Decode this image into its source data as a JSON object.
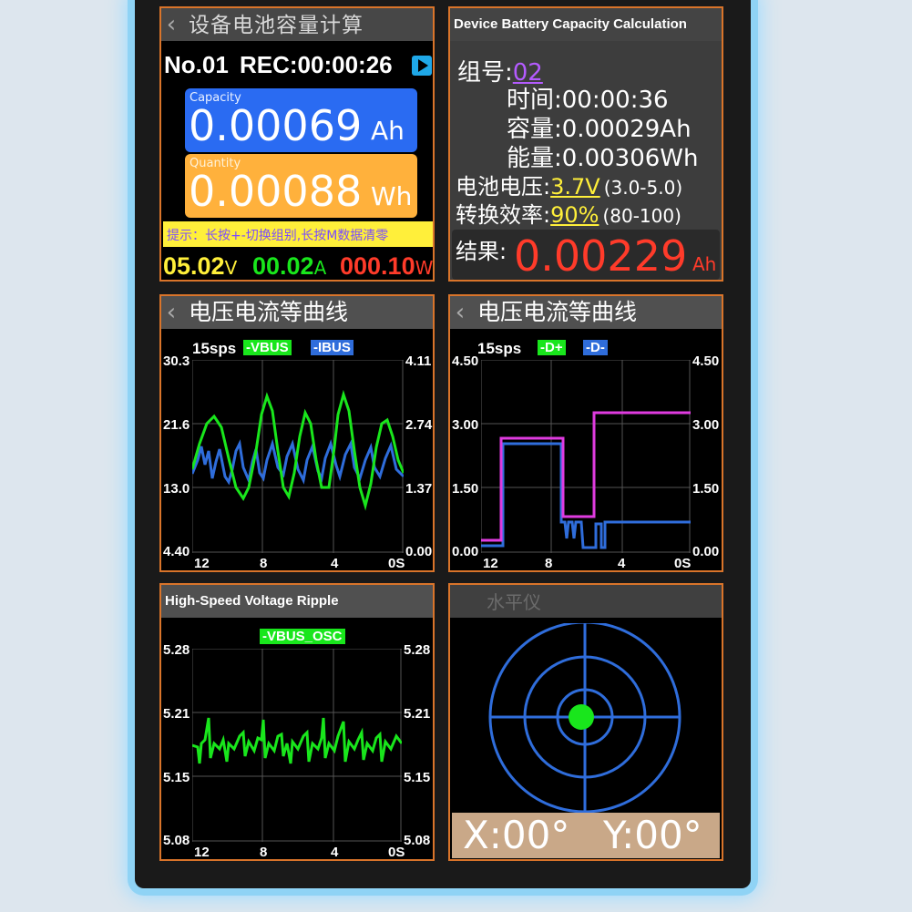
{
  "colors": {
    "accent": "#d9742a",
    "vbus": "#19e61c",
    "ibus": "#2f6ddb",
    "dplus": "#19e61c",
    "dminus": "#2f6ddb",
    "dplus_line": "#e03be0",
    "result": "#ff3b2a",
    "link": "#b45bff",
    "yellow": "#ffef3a"
  },
  "p1": {
    "title": "设备电池容量计算",
    "record": {
      "group": "No.01",
      "time": "REC:00:00:26"
    },
    "play_icon": "play-icon",
    "capacity": {
      "label": "Capacity",
      "value": "0.00069",
      "unit": "Ah"
    },
    "quantity": {
      "label": "Quantity",
      "value": "0.00088",
      "unit": "Wh"
    },
    "tip": "提示：长按+-切换组别,长按M数据清零",
    "voltage": {
      "value": "05.02",
      "unit": "V"
    },
    "current": {
      "value": "00.02",
      "unit": "A"
    },
    "power": {
      "value": "000.10",
      "unit": "W"
    }
  },
  "p2": {
    "title": "Device Battery Capacity Calculation",
    "group_label": "组号:",
    "group_value": "02",
    "time_label": "时间:",
    "time_value": "00:00:36",
    "cap_label": "容量:",
    "cap_value": "0.00029Ah",
    "energy_label": "能量:",
    "energy_value": "0.00306Wh",
    "batt_label": "电池电压:",
    "batt_value": "3.7V",
    "batt_range": "(3.0-5.0)",
    "eff_label": "转换效率:",
    "eff_value": "90%",
    "eff_range": "(80-100)",
    "result_label": "结果:",
    "result_value": "0.00229",
    "result_unit": "Ah"
  },
  "p3": {
    "title": "电压电流等曲线",
    "rate": "15sps",
    "legend1": "-VBUS",
    "legend2": "-IBUS",
    "yleft": [
      "30.3",
      "21.6",
      "13.0",
      "4.40"
    ],
    "yright": [
      "4.11",
      "2.74",
      "1.37",
      "0.00"
    ],
    "x": [
      "12",
      "8",
      "4",
      "0S"
    ]
  },
  "p4": {
    "title": "电压电流等曲线",
    "rate": "15sps",
    "legend1": "-D+",
    "legend2": "-D-",
    "yleft": [
      "4.50",
      "3.00",
      "1.50",
      "0.00"
    ],
    "yright": [
      "4.50",
      "3.00",
      "1.50",
      "0.00"
    ],
    "x": [
      "12",
      "8",
      "4",
      "0S"
    ]
  },
  "p5": {
    "title": "High-Speed Voltage Ripple",
    "legend": "-VBUS_OSC",
    "yleft": [
      "5.28",
      "5.21",
      "5.15",
      "5.08"
    ],
    "yright": [
      "5.28",
      "5.21",
      "5.15",
      "5.08"
    ],
    "x": [
      "12",
      "8",
      "4",
      "0S"
    ]
  },
  "p6": {
    "title": "水平仪",
    "x_readout": "X:00°",
    "y_readout": "Y:00°"
  }
}
